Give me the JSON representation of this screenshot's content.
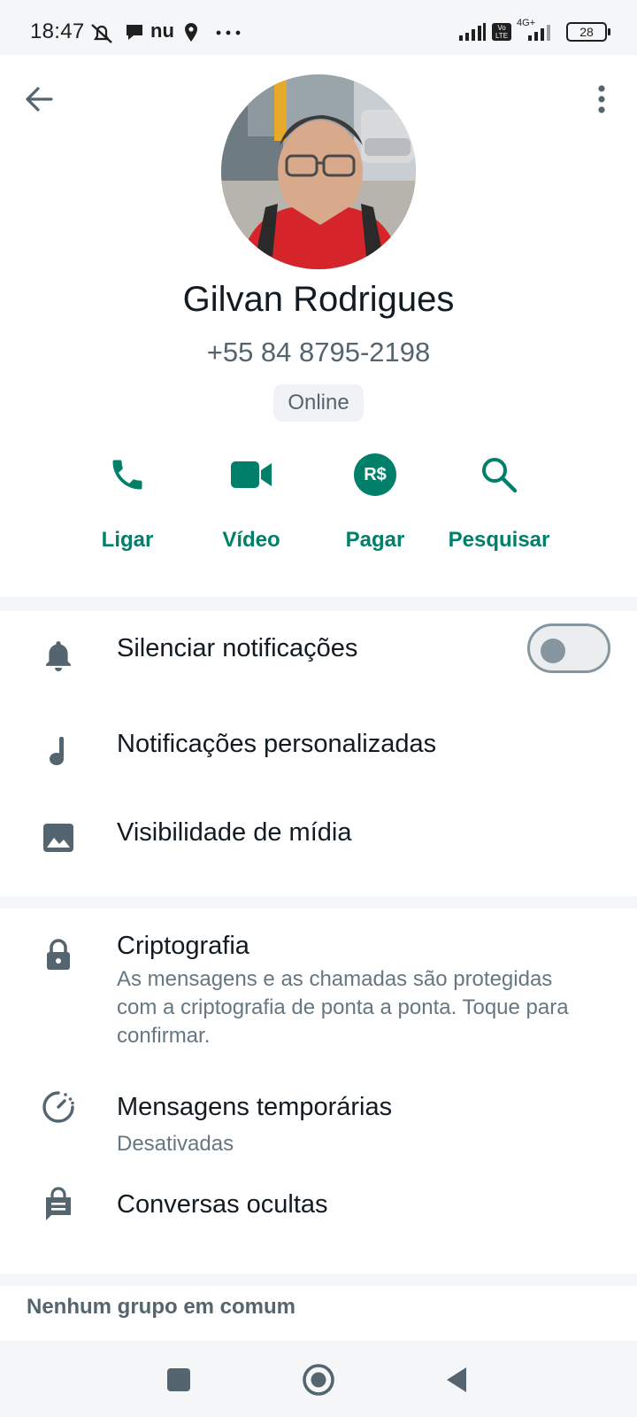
{
  "status_bar": {
    "time": "18:47",
    "carrier_label": "nu",
    "network_label": "4G+",
    "volte_label": "Vo LTE",
    "battery": "28",
    "icons": [
      "mute-icon",
      "chat-bubble-icon",
      "location-icon",
      "more-dots-icon",
      "signal-icon",
      "volte-icon",
      "signal-icon",
      "battery-icon"
    ]
  },
  "header": {
    "back_icon": "arrow-left-icon",
    "more_icon": "vertical-dots-icon"
  },
  "contact": {
    "name": "Gilvan Rodrigues",
    "phone": "+55 84 8795-2198",
    "status": "Online"
  },
  "actions": [
    {
      "label": "Ligar",
      "icon": "phone-icon"
    },
    {
      "label": "Vídeo",
      "icon": "video-icon"
    },
    {
      "label": "Pagar",
      "icon": "pay-icon",
      "badge_text": "R$"
    },
    {
      "label": "Pesquisar",
      "icon": "search-icon"
    }
  ],
  "notifications_section": {
    "mute": {
      "title": "Silenciar notificações",
      "icon": "bell-icon",
      "enabled": false
    },
    "custom": {
      "title": "Notificações personalizadas",
      "icon": "music-note-icon"
    },
    "media": {
      "title": "Visibilidade de mídia",
      "icon": "image-icon"
    }
  },
  "privacy_section": {
    "encryption": {
      "title": "Criptografia",
      "subtitle": "As mensagens e as chamadas são protegidas com a criptografia de ponta a ponta. Toque para confirmar.",
      "icon": "lock-icon"
    },
    "disappearing": {
      "title": "Mensagens temporárias",
      "subtitle": "Desativadas",
      "icon": "timer-icon"
    },
    "hidden": {
      "title": "Conversas ocultas",
      "icon": "chat-lock-icon"
    }
  },
  "groups": {
    "label": "Nenhum grupo em comum"
  },
  "colors": {
    "accent": "#008069",
    "background": "#f5f6f7",
    "card": "#ffffff",
    "icon_gray": "#8696a0"
  }
}
